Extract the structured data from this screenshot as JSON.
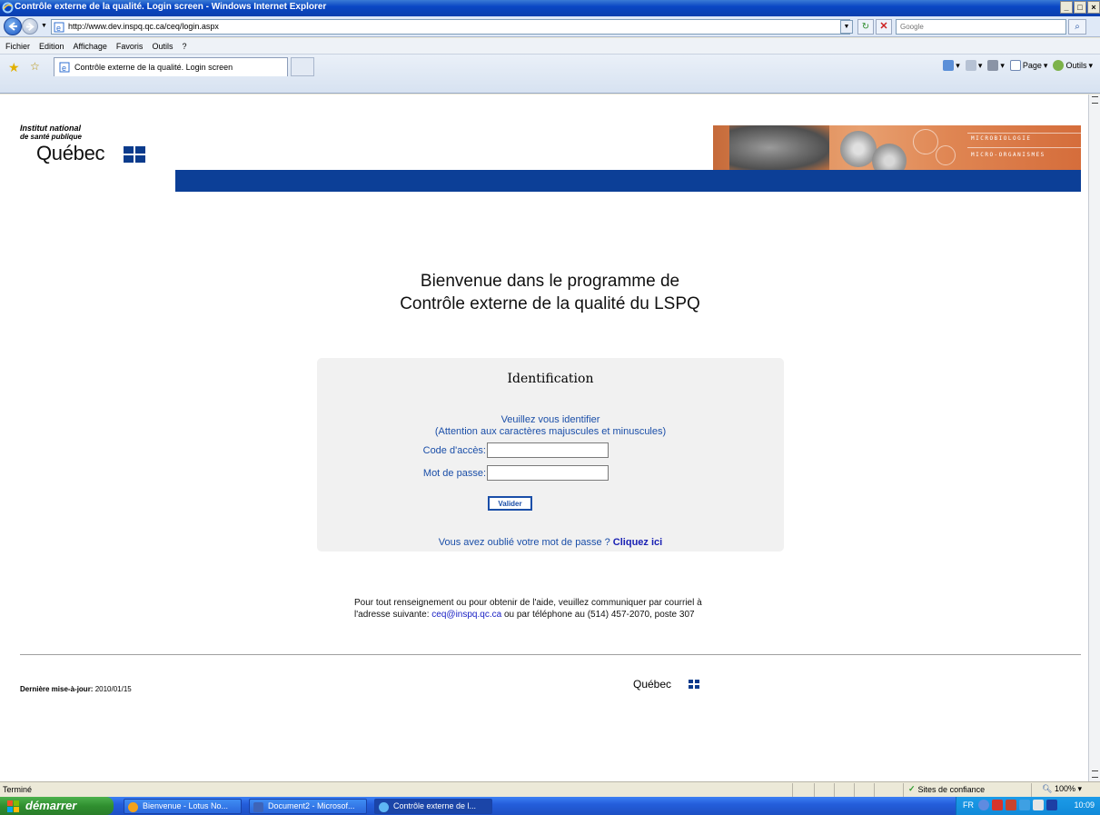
{
  "window": {
    "title": "Contrôle externe de la qualité. Login screen - Windows Internet Explorer",
    "buttons": [
      "_",
      "□",
      "×"
    ]
  },
  "address_bar": {
    "url": "http://www.dev.inspq.qc.ca/ceq/login.aspx",
    "search_placeholder": "Google"
  },
  "menu": [
    "Fichier",
    "Edition",
    "Affichage",
    "Favoris",
    "Outils",
    "?"
  ],
  "tab": {
    "label": "Contrôle externe de la qualité. Login screen"
  },
  "commands": {
    "page": "Page",
    "tools": "Outils"
  },
  "header": {
    "logo_line1": "Institut national",
    "logo_line2": "de santé publique",
    "logo_quebec": "Québec",
    "banner_line1": "MICROBIOLOGIE",
    "banner_line2": "MICRO-ORGANISMES"
  },
  "welcome": {
    "line1": "Bienvenue dans le programme de",
    "line2": "Contrôle externe de la qualité du LSPQ"
  },
  "login": {
    "title": "Identification",
    "instruction1": "Veuillez vous identifier",
    "instruction2": "(Attention aux caractères majuscules et minuscules)",
    "code_label": "Code d'accès:",
    "code_value": "",
    "password_label": "Mot de passe:",
    "password_value": "",
    "submit_label": "Valider",
    "forgot_text": "Vous avez oublié votre mot de passe ?",
    "forgot_link": "Cliquez ici"
  },
  "contact": {
    "line1": "Pour tout renseignement ou pour obtenir de l'aide, veuillez communiquer par courriel à",
    "line2_prefix": "l'adresse suivante:",
    "email": "ceq@inspq.qc.ca",
    "line2_suffix": "ou par téléphone au (514) 457-2070, poste 307"
  },
  "footer": {
    "last_update_label": "Dernière mise-à-jour:",
    "last_update_value": "2010/01/15",
    "quebec": "Québec"
  },
  "status": {
    "text": "Terminé",
    "zone": "Sites de confiance",
    "zoom": "100%"
  },
  "taskbar": {
    "start": "démarrer",
    "items": [
      "Bienvenue - Lotus No...",
      "Document2 - Microsof...",
      "Contrôle externe de l..."
    ],
    "lang": "FR",
    "clock": "10:09"
  },
  "colors": {
    "banner_blue": "#0c3f97",
    "link_blue": "#1a4ea8",
    "panel_bg": "#f1f1f1"
  }
}
